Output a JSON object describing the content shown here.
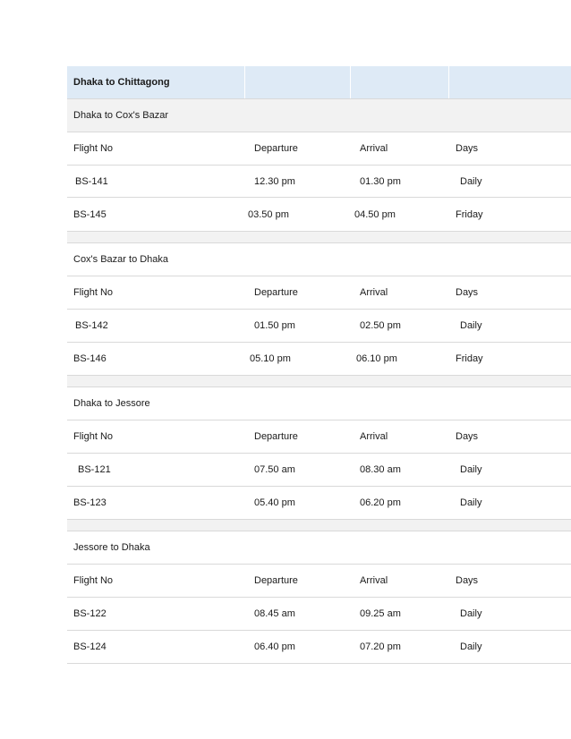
{
  "document": {
    "header_title": "Dhaka to Chittagong",
    "columns": {
      "flight_no": "Flight No",
      "departure": "Departure",
      "arrival": "Arrival",
      "days": "Days"
    },
    "routes": [
      {
        "title": "Dhaka to Cox's Bazar",
        "flights": [
          {
            "flight_no": "BS-141",
            "departure": "12.30 pm",
            "arrival": "01.30 pm",
            "days": "Daily"
          },
          {
            "flight_no": "BS-145",
            "departure": "03.50 pm",
            "arrival": "04.50 pm",
            "days": "Friday"
          }
        ]
      },
      {
        "title": "Cox's Bazar to Dhaka",
        "flights": [
          {
            "flight_no": "BS-142",
            "departure": "01.50 pm",
            "arrival": "02.50 pm",
            "days": "Daily"
          },
          {
            "flight_no": "BS-146",
            "departure": "05.10 pm",
            "arrival": "06.10 pm",
            "days": "Friday"
          }
        ]
      },
      {
        "title": "Dhaka to Jessore",
        "flights": [
          {
            "flight_no": "BS-121",
            "departure": "07.50 am",
            "arrival": "08.30 am",
            "days": "Daily"
          },
          {
            "flight_no": "BS-123",
            "departure": "05.40 pm",
            "arrival": "06.20 pm",
            "days": "Daily"
          }
        ]
      },
      {
        "title": "Jessore to Dhaka",
        "flights": [
          {
            "flight_no": "BS-122",
            "departure": "08.45 am",
            "arrival": "09.25 am",
            "days": "Daily"
          },
          {
            "flight_no": "BS-124",
            "departure": "06.40 pm",
            "arrival": "07.20 pm",
            "days": "Daily"
          }
        ]
      }
    ]
  }
}
